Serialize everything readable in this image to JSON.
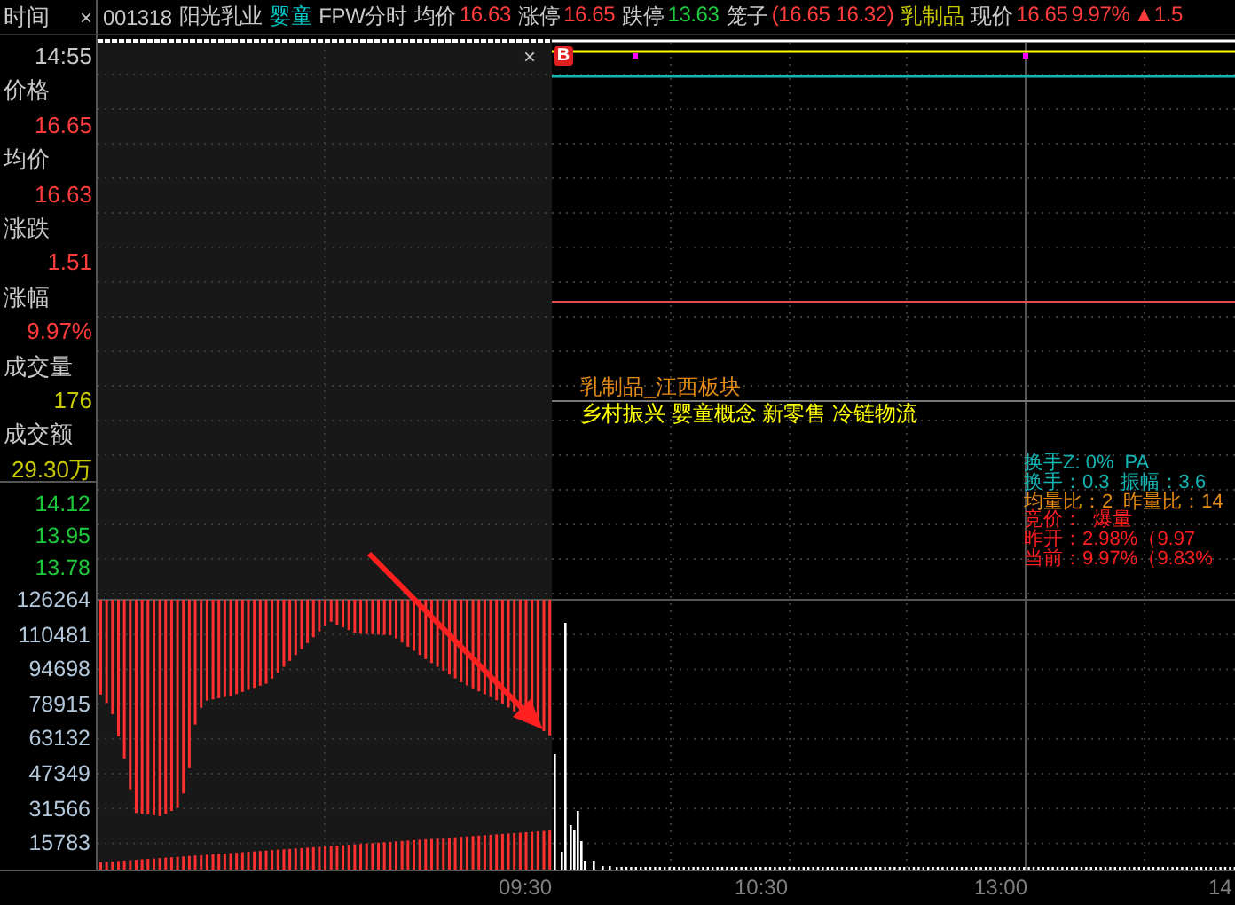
{
  "header": {
    "title": "时间",
    "close": "×",
    "code": "001318",
    "name": "阳光乳业",
    "tag": "婴童",
    "mode": "FPW分时",
    "items": [
      {
        "kind": "quote",
        "label": "均价",
        "values": [
          "16.63"
        ],
        "color": "#ff3c3c"
      },
      {
        "kind": "quote",
        "label": "涨停",
        "values": [
          "16.65"
        ],
        "color": "#ff3c3c"
      },
      {
        "kind": "quote",
        "label": "跌停",
        "values": [
          "13.63"
        ],
        "color": "#1ec83c"
      },
      {
        "kind": "quote",
        "label": "笼子",
        "values": [
          "(16.65 16.32)"
        ],
        "color": "#ff3c3c"
      },
      {
        "kind": "sector",
        "label": "乳制品",
        "color": "#c8c800"
      },
      {
        "kind": "quote",
        "label": "现价",
        "values": [
          "16.65",
          "9.97%",
          "▲1.5"
        ],
        "color": "#ff3c3c"
      }
    ]
  },
  "side_panel": {
    "time": "14:55",
    "rows": [
      {
        "label": "价格",
        "value": "16.65",
        "color": "#ff3c3c"
      },
      {
        "label": "均价",
        "value": "16.63",
        "color": "#ff3c3c"
      },
      {
        "label": "涨跌",
        "value": "1.51",
        "color": "#ff3c3c"
      },
      {
        "label": "涨幅",
        "value": "9.97%",
        "color": "#ff3c3c"
      },
      {
        "label": "成交量",
        "value": "176",
        "color": "#c8c800"
      },
      {
        "label": "成交额",
        "value": "29.30万",
        "color": "#c8c800"
      }
    ],
    "price_axis": [
      "14.12",
      "13.95",
      "13.78"
    ],
    "volume_axis": [
      "126264",
      "110481",
      "94698",
      "78915",
      "63132",
      "47349",
      "31566",
      "15783"
    ]
  },
  "chart": {
    "marker": "B",
    "overlay_close": "×",
    "sector_line": "乳制品_江西板块",
    "concepts": "乡村振兴 婴童概念 新零售 冷链物流",
    "stats": [
      {
        "texts": [
          "换手Z: 0%",
          "PA"
        ],
        "color": "#14b4b4"
      },
      {
        "texts": [
          "换手：0.3",
          "振幅：3.6"
        ],
        "color": "#14b4b4"
      },
      {
        "texts": [
          "均量比：2",
          "昨量比：14"
        ],
        "color": "#e68c14"
      },
      {
        "texts": [
          "竞价：",
          "爆量"
        ],
        "color": "#ff1e1e"
      },
      {
        "texts": [
          "昨开：2.98%（9.97"
        ],
        "color": "#ff1e1e"
      },
      {
        "texts": [
          "当前：9.97%（9.83%"
        ],
        "color": "#ff1e1e"
      }
    ]
  },
  "time_axis": [
    "09:30",
    "10:30",
    "13:00",
    "14"
  ]
}
